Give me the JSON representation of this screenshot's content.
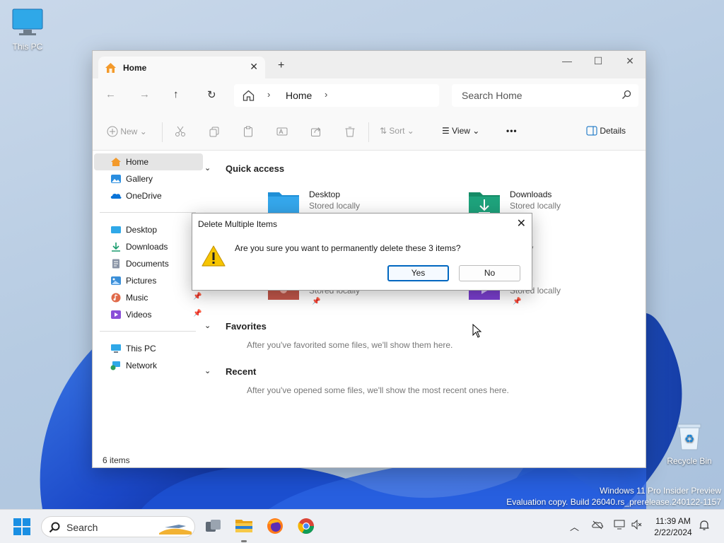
{
  "desktop": {
    "icons": [
      {
        "label": "This PC"
      },
      {
        "label": "Recycle Bin"
      }
    ],
    "watermark_line1": "Windows 11 Pro Insider Preview",
    "watermark_line2": "Evaluation copy. Build 26040.rs_prerelease.240122-1157"
  },
  "explorer": {
    "tab_label": "Home",
    "tab_close": "✕",
    "new_tab": "+",
    "window_controls": {
      "minimize": "—",
      "maximize": "☐",
      "close": "✕"
    },
    "nav_buttons": {
      "back": "←",
      "forward": "→",
      "up": "↑",
      "refresh": "↻"
    },
    "breadcrumb": {
      "sep": "›",
      "current": "Home"
    },
    "search_placeholder": "Search Home",
    "command_bar": {
      "new": "New",
      "sort": "Sort",
      "view": "View",
      "more": "•••",
      "details": "Details"
    },
    "nav_pane": {
      "top": [
        {
          "label": "Home"
        },
        {
          "label": "Gallery"
        },
        {
          "label": "OneDrive"
        }
      ],
      "pinned": [
        {
          "label": "Desktop"
        },
        {
          "label": "Downloads"
        },
        {
          "label": "Documents"
        },
        {
          "label": "Pictures"
        },
        {
          "label": "Music"
        },
        {
          "label": "Videos"
        }
      ],
      "bottom": [
        {
          "label": "This PC"
        },
        {
          "label": "Network"
        }
      ]
    },
    "sections": {
      "quick_access": "Quick access",
      "favorites": "Favorites",
      "favorites_empty": "After you've favorited some files, we'll show them here.",
      "recent": "Recent",
      "recent_empty": "After you've opened some files, we'll show the most recent ones here."
    },
    "quick_access_items": [
      {
        "name": "Desktop",
        "sub": "Stored locally"
      },
      {
        "name": "Downloads",
        "sub": "Stored locally"
      },
      {
        "name": "es",
        "sub": "locally"
      },
      {
        "name": "",
        "sub": "Stored locally"
      },
      {
        "name": "s",
        "sub": "Stored locally"
      }
    ],
    "status": "6 items"
  },
  "dialog": {
    "title": "Delete Multiple Items",
    "close": "✕",
    "message": "Are you sure you want to permanently delete these 3 items?",
    "yes": "Yes",
    "no": "No"
  },
  "taskbar": {
    "search_placeholder": "Search",
    "time": "11:39 AM",
    "date": "2/22/2024"
  },
  "colors": {
    "accent": "#0067c0",
    "folder_blue": "#1f8fd6",
    "folder_green": "#1ea37c",
    "warning": "#f7c500"
  }
}
